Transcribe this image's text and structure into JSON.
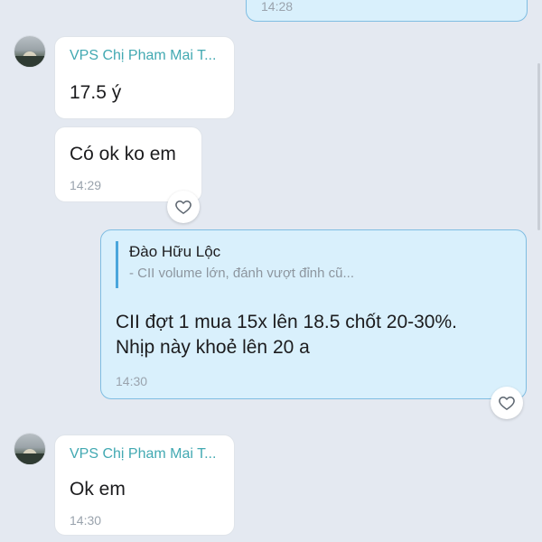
{
  "messages": [
    {
      "time": "14:28"
    },
    {
      "sender": "VPS Chị Pham Mai T...",
      "text": "17.5 ý"
    },
    {
      "text": "Có ok ko em",
      "time": "14:29",
      "reaction_icon": "heart-outline-icon"
    },
    {
      "quote_author": "Đào Hữu Lộc",
      "quote_text": "- CII volume lớn, đánh vượt đỉnh cũ...",
      "line1": "CII đợt 1 mua 15x lên 18.5 chốt 20-30%.",
      "line2": "Nhịp này khoẻ lên 20 a",
      "time": "14:30",
      "reaction_icon": "heart-outline-icon"
    },
    {
      "sender": "VPS Chị Pham Mai T...",
      "text": "Ok em",
      "time": "14:30"
    }
  ],
  "colors": {
    "background": "#e4e9f1",
    "incoming_bubble": "#ffffff",
    "outgoing_bubble": "#d9f0fc",
    "outgoing_border": "#7fbde2",
    "sender_name": "#42a9b2",
    "quote_bar": "#4aa6dc",
    "timestamp": "#9aa3ad"
  }
}
